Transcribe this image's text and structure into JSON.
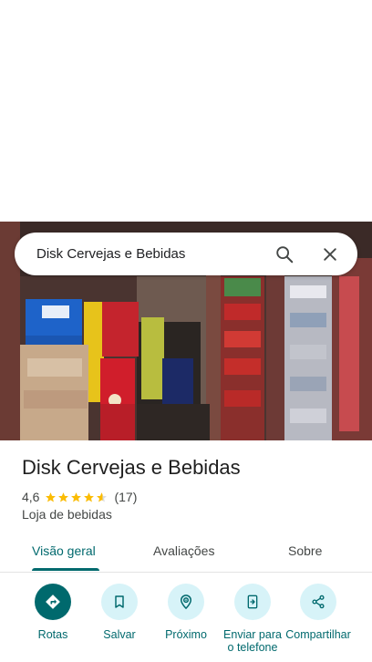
{
  "search": {
    "query": "Disk Cervejas e Bebidas"
  },
  "place": {
    "name": "Disk Cervejas e Bebidas",
    "rating": "4,6",
    "stars": 4.6,
    "review_count": "(17)",
    "category": "Loja de bebidas"
  },
  "tabs": [
    {
      "label": "Visão geral",
      "active": true
    },
    {
      "label": "Avaliações",
      "active": false
    },
    {
      "label": "Sobre",
      "active": false
    }
  ],
  "actions": [
    {
      "label": "Rotas",
      "icon": "directions-icon"
    },
    {
      "label": "Salvar",
      "icon": "bookmark-icon"
    },
    {
      "label": "Próximo",
      "icon": "nearby-icon"
    },
    {
      "label": "Enviar para o telefone",
      "icon": "send-to-phone-icon"
    },
    {
      "label": "Compartilhar",
      "icon": "share-icon"
    }
  ],
  "colors": {
    "accent": "#00696d",
    "action_bg": "#d7f3f8",
    "star": "#fbbc04"
  }
}
